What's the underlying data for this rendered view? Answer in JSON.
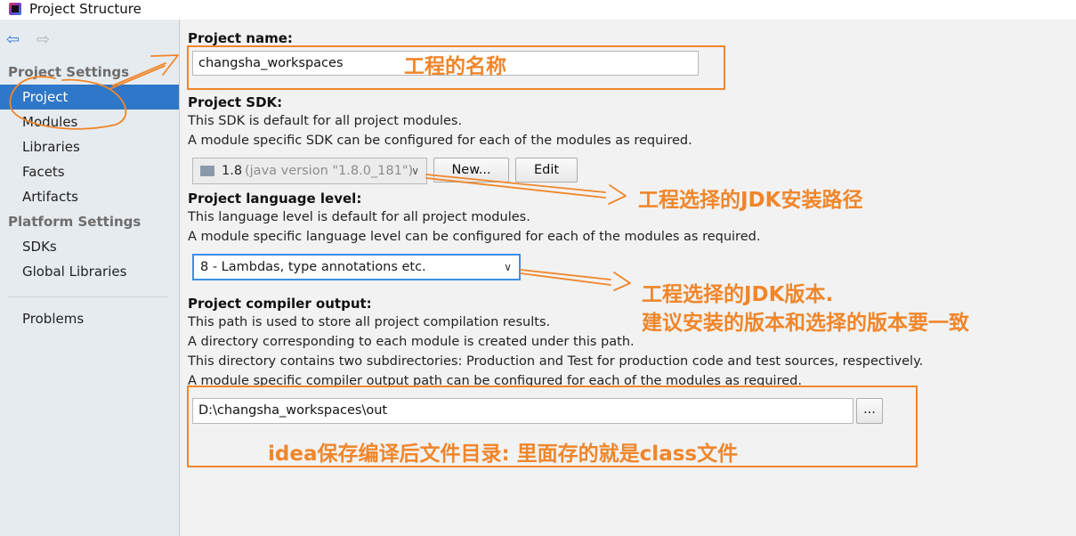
{
  "window": {
    "title": "Project Structure"
  },
  "sidebar": {
    "section_project": "Project Settings",
    "items_project": [
      {
        "label": "Project",
        "selected": true
      },
      {
        "label": "Modules"
      },
      {
        "label": "Libraries"
      },
      {
        "label": "Facets"
      },
      {
        "label": "Artifacts"
      }
    ],
    "section_platform": "Platform Settings",
    "items_platform": [
      {
        "label": "SDKs"
      },
      {
        "label": "Global Libraries"
      }
    ],
    "problems": "Problems"
  },
  "main": {
    "name_label": "Project name:",
    "name_value": "changsha_workspaces",
    "sdk_label": "Project SDK:",
    "sdk_desc1": "This SDK is default for all project modules.",
    "sdk_desc2": "A module specific SDK can be configured for each of the modules as required.",
    "sdk_value": "1.8",
    "sdk_version": "(java version \"1.8.0_181\")",
    "new_button": "New...",
    "edit_button": "Edit",
    "lang_label": "Project language level:",
    "lang_desc1": "This language level is default for all project modules.",
    "lang_desc2": "A module specific language level can be configured for each of the modules as required.",
    "lang_value": "8 - Lambdas, type annotations etc.",
    "out_label": "Project compiler output:",
    "out_desc1": "This path is used to store all project compilation results.",
    "out_desc2": "A directory corresponding to each module is created under this path.",
    "out_desc3": "This directory contains two subdirectories: Production and Test for production code and test sources, respectively.",
    "out_desc4": "A module specific compiler output path can be configured for each of the modules as required.",
    "out_value": "D:\\changsha_workspaces\\out",
    "browse_button": "..."
  },
  "annotations": {
    "name": "工程的名称",
    "sdk": "工程选择的JDK安装路径",
    "lang1": "工程选择的JDK版本.",
    "lang2": "建议安装的版本和选择的版本要一致",
    "output": "idea保存编译后文件目录: 里面存的就是class文件",
    "color": "#f0862a"
  },
  "colors": {
    "selection": "#2f77c8",
    "sidebar_bg": "#e6ebf0",
    "focus": "#3d8ee6"
  }
}
